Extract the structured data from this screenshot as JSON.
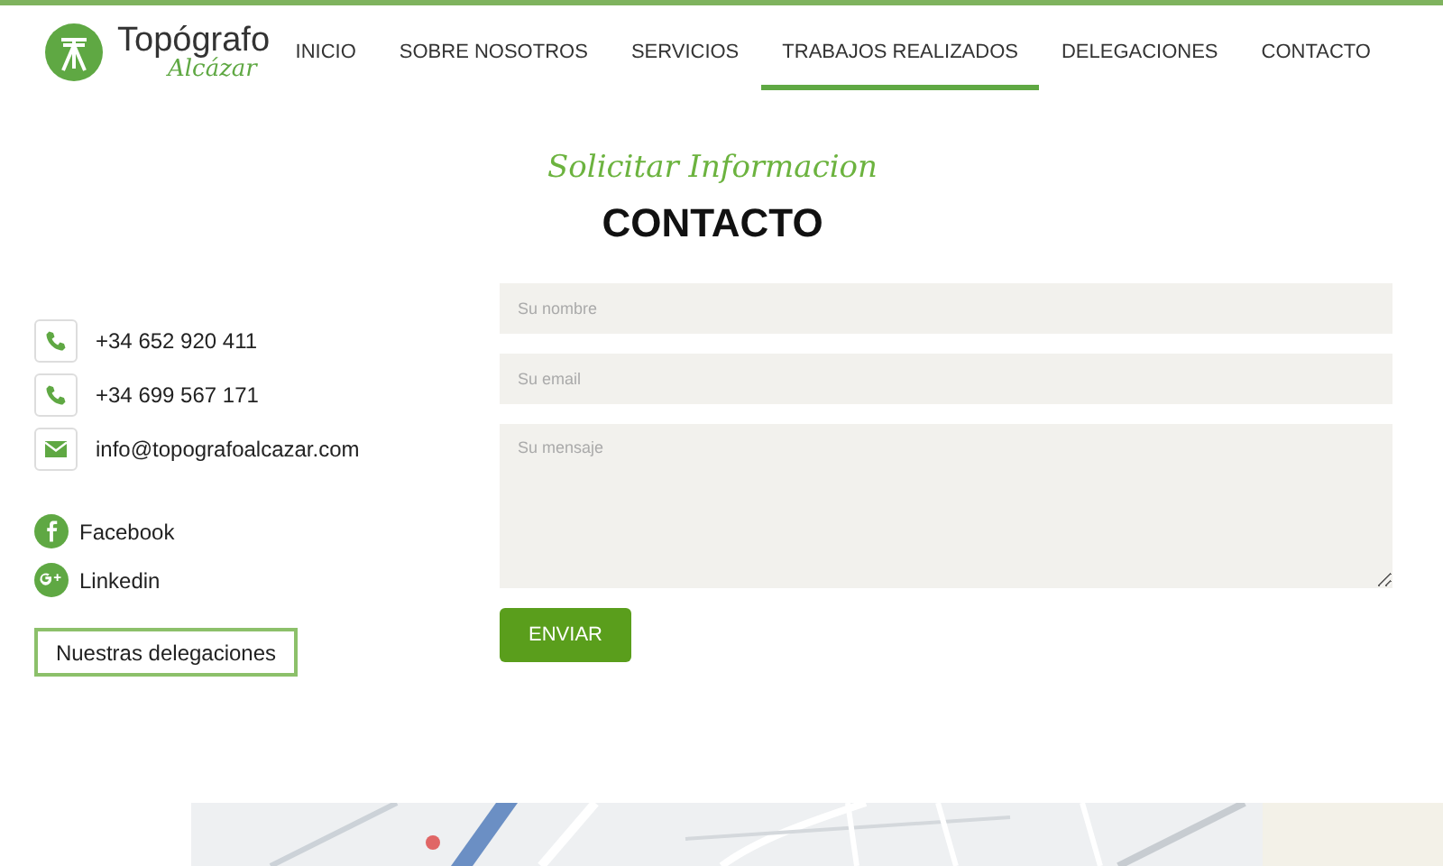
{
  "logo": {
    "name": "Topógrafo",
    "subtitle": "Alcázar"
  },
  "nav": [
    {
      "label": "INICIO",
      "selected": false
    },
    {
      "label": "SOBRE NOSOTROS",
      "selected": false
    },
    {
      "label": "SERVICIOS",
      "selected": false
    },
    {
      "label": "TRABAJOS REALIZADOS",
      "selected": true
    },
    {
      "label": "DELEGACIONES",
      "selected": false
    },
    {
      "label": "CONTACTO",
      "selected": false
    }
  ],
  "section": {
    "tagline": "Solicitar Informacion",
    "title": "CONTACTO"
  },
  "contacts": [
    {
      "kind": "phone",
      "text": "+34 652 920 411"
    },
    {
      "kind": "phone",
      "text": "+34 699 567 171"
    },
    {
      "kind": "email",
      "text": "info@topografoalcazar.com"
    }
  ],
  "social": [
    {
      "kind": "facebook",
      "label": "Facebook"
    },
    {
      "kind": "googleplus",
      "label": "Linkedin"
    }
  ],
  "delegations_button": "Nuestras delegaciones",
  "form": {
    "name_placeholder": "Su nombre",
    "email_placeholder": "Su email",
    "message_placeholder": "Su mensaje",
    "submit": "ENVIAR"
  }
}
